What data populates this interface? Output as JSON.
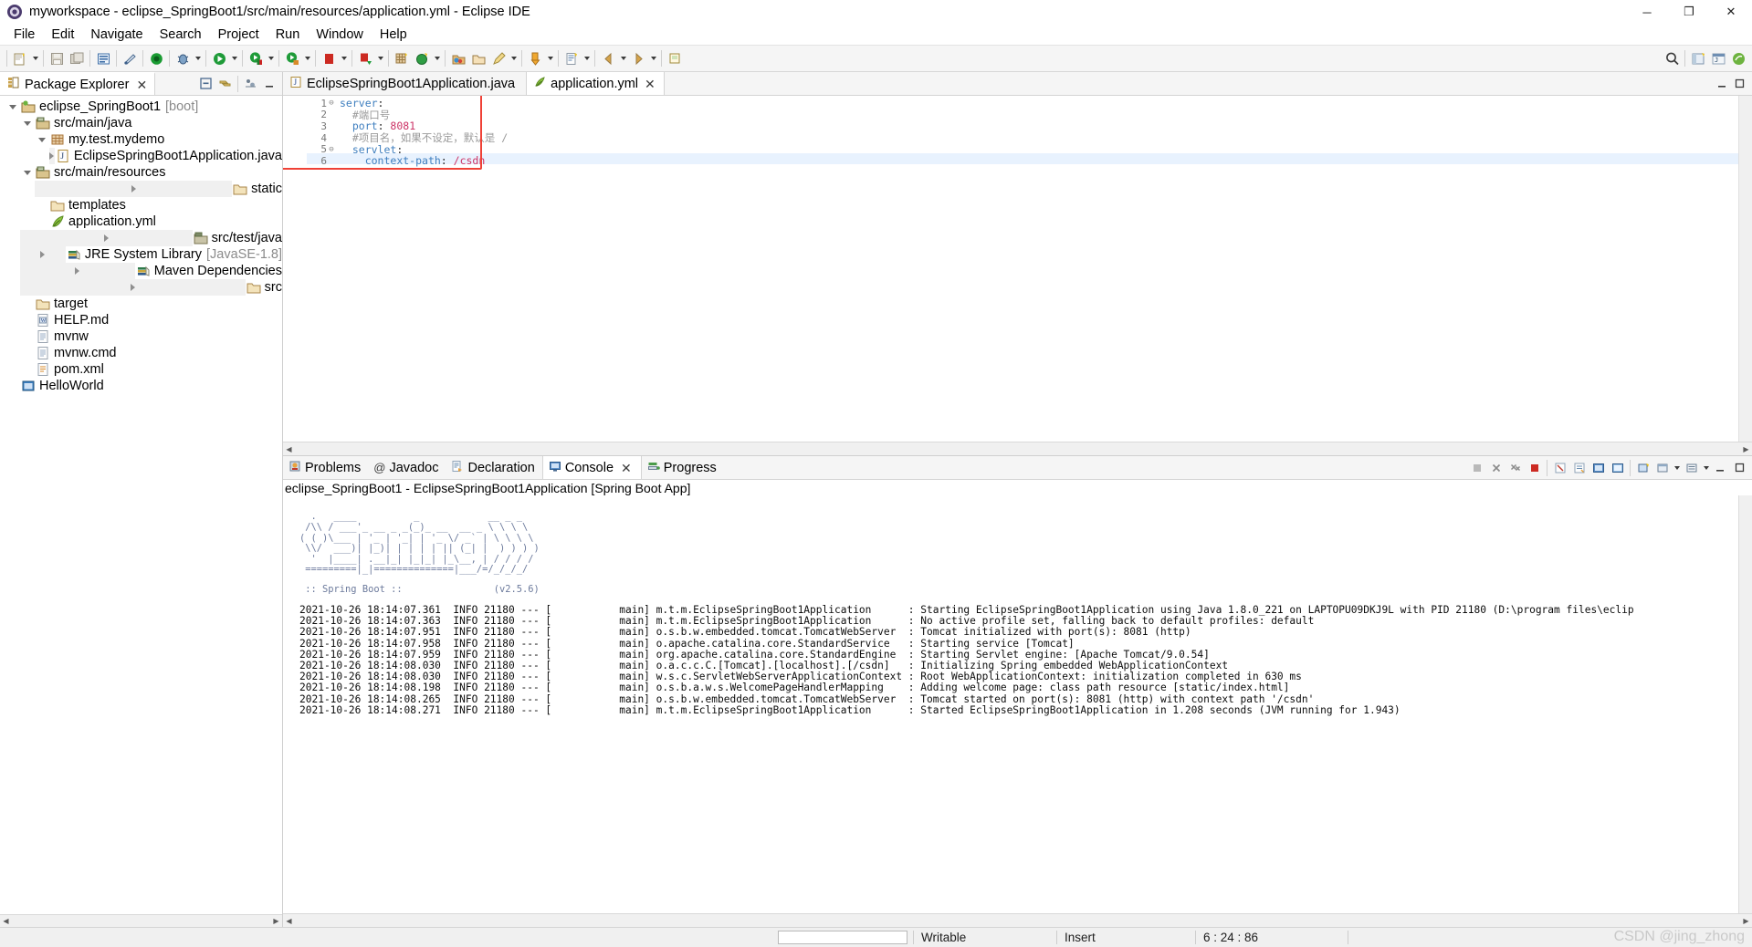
{
  "window": {
    "title": "myworkspace - eclipse_SpringBoot1/src/main/resources/application.yml - Eclipse IDE",
    "minimize": "─",
    "maximize": "❐",
    "close": "✕"
  },
  "menubar": {
    "items": [
      "File",
      "Edit",
      "Navigate",
      "Search",
      "Project",
      "Run",
      "Window",
      "Help"
    ]
  },
  "explorer": {
    "tab_label": "Package Explorer",
    "close": "✕",
    "tree": [
      {
        "indent": 0,
        "twisty": "down",
        "icon": "project-boot-icon",
        "label": "eclipse_SpringBoot1",
        "suffix": "[boot]"
      },
      {
        "indent": 1,
        "twisty": "down",
        "icon": "source-folder-icon",
        "label": "src/main/java",
        "suffix": ""
      },
      {
        "indent": 2,
        "twisty": "down",
        "icon": "package-icon",
        "label": "my.test.mydemo",
        "suffix": ""
      },
      {
        "indent": 3,
        "twisty": "right",
        "icon": "java-file-icon",
        "label": "EclipseSpringBoot1Application.java",
        "suffix": ""
      },
      {
        "indent": 1,
        "twisty": "down",
        "icon": "source-folder-icon",
        "label": "src/main/resources",
        "suffix": ""
      },
      {
        "indent": 2,
        "twisty": "right",
        "icon": "folder-icon",
        "label": "static",
        "suffix": ""
      },
      {
        "indent": 2,
        "twisty": "none",
        "icon": "folder-icon",
        "label": "templates",
        "suffix": ""
      },
      {
        "indent": 2,
        "twisty": "none",
        "icon": "yaml-file-icon",
        "label": "application.yml",
        "suffix": ""
      },
      {
        "indent": 1,
        "twisty": "right",
        "icon": "test-folder-icon",
        "label": "src/test/java",
        "suffix": ""
      },
      {
        "indent": 1,
        "twisty": "right",
        "icon": "library-icon",
        "label": "JRE System Library",
        "suffix": "[JavaSE-1.8]"
      },
      {
        "indent": 1,
        "twisty": "right",
        "icon": "library-icon",
        "label": "Maven Dependencies",
        "suffix": ""
      },
      {
        "indent": 1,
        "twisty": "right",
        "icon": "folder-icon",
        "label": "src",
        "suffix": ""
      },
      {
        "indent": 1,
        "twisty": "none",
        "icon": "folder-icon",
        "label": "target",
        "suffix": ""
      },
      {
        "indent": 1,
        "twisty": "none",
        "icon": "md-file-icon",
        "label": "HELP.md",
        "suffix": ""
      },
      {
        "indent": 1,
        "twisty": "none",
        "icon": "file-icon",
        "label": "mvnw",
        "suffix": ""
      },
      {
        "indent": 1,
        "twisty": "none",
        "icon": "file-icon",
        "label": "mvnw.cmd",
        "suffix": ""
      },
      {
        "indent": 1,
        "twisty": "none",
        "icon": "xml-file-icon",
        "label": "pom.xml",
        "suffix": ""
      },
      {
        "indent": 0,
        "twisty": "none",
        "icon": "project-closed-icon",
        "label": "HelloWorld",
        "suffix": ""
      }
    ]
  },
  "editor": {
    "tabs": [
      {
        "label": "EclipseSpringBoot1Application.java",
        "icon": "java-file-icon",
        "active": false,
        "closable": false
      },
      {
        "label": "application.yml",
        "icon": "yaml-file-icon",
        "active": true,
        "closable": true,
        "close": "✕"
      }
    ],
    "lines": [
      {
        "num": "1",
        "fold": "⊖",
        "segments": [
          {
            "t": "server",
            "c": "k-key"
          },
          {
            "t": ":",
            "c": "k-pun"
          }
        ]
      },
      {
        "num": "2",
        "fold": "",
        "segments": [
          {
            "t": "  ",
            "c": "k-pun"
          },
          {
            "t": "#端口号",
            "c": "k-com"
          }
        ]
      },
      {
        "num": "3",
        "fold": "",
        "segments": [
          {
            "t": "  ",
            "c": "k-pun"
          },
          {
            "t": "port",
            "c": "k-key"
          },
          {
            "t": ": ",
            "c": "k-pun"
          },
          {
            "t": "8081",
            "c": "k-num"
          }
        ]
      },
      {
        "num": "4",
        "fold": "",
        "segments": [
          {
            "t": "  ",
            "c": "k-pun"
          },
          {
            "t": "#项目名，如果不设定，默认是 /",
            "c": "k-com"
          }
        ]
      },
      {
        "num": "5",
        "fold": "⊖",
        "segments": [
          {
            "t": "  ",
            "c": "k-pun"
          },
          {
            "t": "servlet",
            "c": "k-key"
          },
          {
            "t": ":",
            "c": "k-pun"
          }
        ]
      },
      {
        "num": "6",
        "fold": "",
        "segments": [
          {
            "t": "    ",
            "c": "k-pun"
          },
          {
            "t": "context-path",
            "c": "k-key"
          },
          {
            "t": ": ",
            "c": "k-pun"
          },
          {
            "t": "/csdn",
            "c": "k-num"
          }
        ]
      }
    ],
    "highlight_line_index": 5,
    "annotation_color": "#ef4136"
  },
  "console": {
    "tabs": [
      {
        "label": "Problems",
        "icon": "problems-icon",
        "active": false,
        "closable": false
      },
      {
        "label": "Javadoc",
        "icon": "javadoc-icon",
        "active": false,
        "closable": false
      },
      {
        "label": "Declaration",
        "icon": "declaration-icon",
        "active": false,
        "closable": false
      },
      {
        "label": "Console",
        "icon": "console-icon",
        "active": true,
        "closable": true,
        "close": "✕"
      },
      {
        "label": "Progress",
        "icon": "progress-icon",
        "active": false,
        "closable": false
      }
    ],
    "launch_header": "eclipse_SpringBoot1 - EclipseSpringBoot1Application [Spring Boot App]",
    "banner": "  .   ____          _            __ _ _\n /\\\\ / ___'_ __ _ _(_)_ __  __ _ \\ \\ \\ \\\n( ( )\\___ | '_ | '_| | '_ \\/ _` | \\ \\ \\ \\\n \\\\/  ___)| |_)| | | | | || (_| |  ) ) ) )\n  '  |____| .__|_| |_|_| |_\\__, | / / / /\n =========|_|==============|___/=/_/_/_/",
    "banner_version": " :: Spring Boot ::                (v2.5.6)",
    "logs": [
      "2021-10-26 18:14:07.361  INFO 21180 --- [           main] m.t.m.EclipseSpringBoot1Application      : Starting EclipseSpringBoot1Application using Java 1.8.0_221 on LAPTOPU09DKJ9L with PID 21180 (D:\\program files\\eclip",
      "2021-10-26 18:14:07.363  INFO 21180 --- [           main] m.t.m.EclipseSpringBoot1Application      : No active profile set, falling back to default profiles: default",
      "2021-10-26 18:14:07.951  INFO 21180 --- [           main] o.s.b.w.embedded.tomcat.TomcatWebServer  : Tomcat initialized with port(s): 8081 (http)",
      "2021-10-26 18:14:07.958  INFO 21180 --- [           main] o.apache.catalina.core.StandardService   : Starting service [Tomcat]",
      "2021-10-26 18:14:07.959  INFO 21180 --- [           main] org.apache.catalina.core.StandardEngine  : Starting Servlet engine: [Apache Tomcat/9.0.54]",
      "2021-10-26 18:14:08.030  INFO 21180 --- [           main] o.a.c.c.C.[Tomcat].[localhost].[/csdn]   : Initializing Spring embedded WebApplicationContext",
      "2021-10-26 18:14:08.030  INFO 21180 --- [           main] w.s.c.ServletWebServerApplicationContext : Root WebApplicationContext: initialization completed in 630 ms",
      "2021-10-26 18:14:08.198  INFO 21180 --- [           main] o.s.b.a.w.s.WelcomePageHandlerMapping    : Adding welcome page: class path resource [static/index.html]",
      "2021-10-26 18:14:08.265  INFO 21180 --- [           main] o.s.b.w.embedded.tomcat.TomcatWebServer  : Tomcat started on port(s): 8081 (http) with context path '/csdn'",
      "2021-10-26 18:14:08.271  INFO 21180 --- [           main] m.t.m.EclipseSpringBoot1Application      : Started EclipseSpringBoot1Application in 1.208 seconds (JVM running for 1.943)"
    ]
  },
  "statusbar": {
    "writable": "Writable",
    "insert": "Insert",
    "position": "6 : 24 : 86"
  },
  "watermark": "CSDN @jing_zhong"
}
